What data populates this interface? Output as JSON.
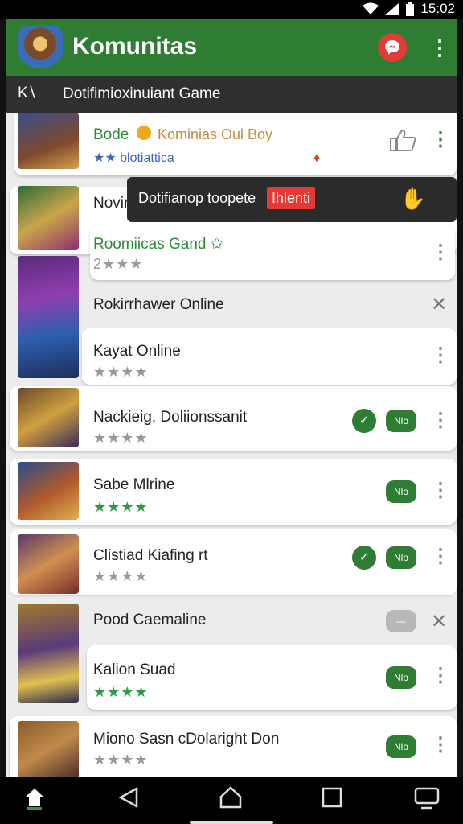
{
  "status": {
    "time": "15:02",
    "wifi_icon": "wifi-icon",
    "signal_icon": "signal-icon",
    "battery_icon": "battery-icon"
  },
  "app": {
    "title": "Komunitas",
    "messenger_icon": "messenger-icon",
    "more_icon": "more-vert-icon"
  },
  "subheader": {
    "back_label": "K∖",
    "title": "Dotifimioxinuiant Game"
  },
  "toast": {
    "text": "Dotifianop toopete",
    "highlight": "Ihlenti",
    "icon": "waving-hand-icon"
  },
  "items": [
    {
      "title": "Bode",
      "title_extra": "Kominias Oul Boy",
      "subtitle": "★★ blotiattica",
      "action": "thumbs-up"
    },
    {
      "title": "Novir",
      "partial": true
    },
    {
      "title": "Roomiicas Gand ✩",
      "rating": "2★★★"
    },
    {
      "title": "Rokirrhawer Online",
      "dismissible": true
    },
    {
      "title": "Kayat Online",
      "rating": "★★★★"
    },
    {
      "title": "Nackieig, Doliionssanit",
      "rating": "★★★★",
      "check": "✓",
      "pill": "Nlo"
    },
    {
      "title": "Sabe Mlrine",
      "rating": "★★★★",
      "pill": "Nlo"
    },
    {
      "title": "Clistiad Kiafing rt",
      "rating": "★★★★",
      "check": "✓",
      "pill": "Nlo"
    },
    {
      "title": "Pood Caemaline",
      "dismissible": true,
      "pill": "—"
    },
    {
      "title": "Kalion Suad",
      "rating": "★★★★",
      "pill": "Nlo"
    },
    {
      "title": "Miono Sasn cDolaright Don",
      "rating": "★★★★",
      "pill": "Nlo"
    }
  ],
  "navbar": {
    "home_icon": "home-icon",
    "back_icon": "back-triangle-icon",
    "home_circle_icon": "home-outline-icon",
    "recents_icon": "recents-square-icon",
    "screenshot_icon": "screenshot-icon"
  }
}
